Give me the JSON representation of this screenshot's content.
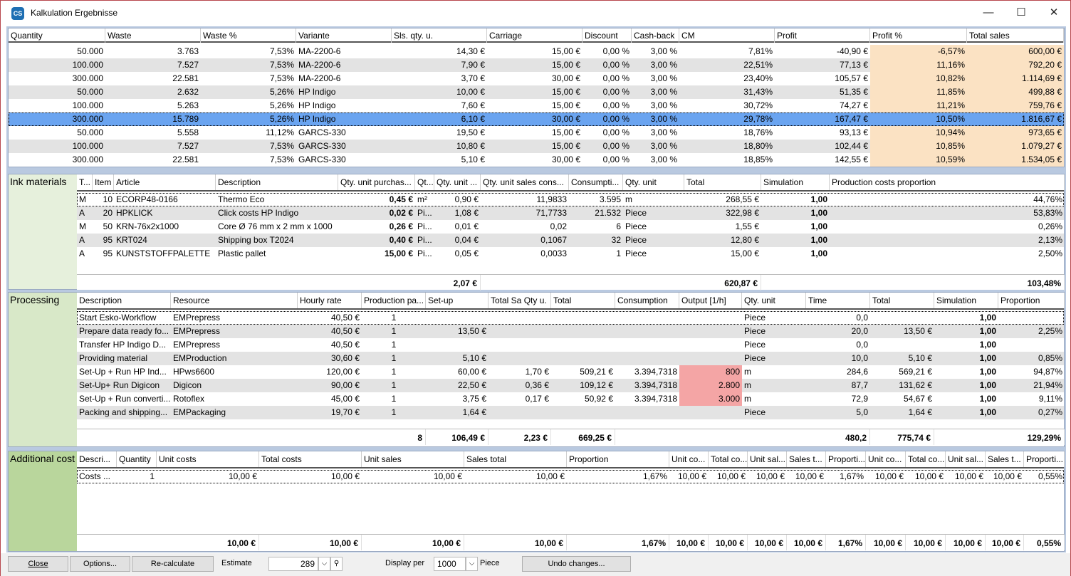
{
  "window": {
    "title": "Kalkulation Ergebnisse",
    "minimize": "—",
    "maximize": "☐",
    "close": "✕"
  },
  "results": {
    "headers": [
      "Quantity",
      "Waste",
      "Waste %",
      "Variante",
      "Sls. qty. u.",
      "Carriage",
      "Discount",
      "Cash-back",
      "CM",
      "Profit",
      "Profit %",
      "Total sales"
    ],
    "rows": [
      [
        "50.000",
        "3.763",
        "7,53%",
        "MA-2200-6",
        "14,30 €",
        "15,00 €",
        "0,00 %",
        "3,00 %",
        "7,81%",
        "-40,90 €",
        "-6,57%",
        "600,00 €"
      ],
      [
        "100.000",
        "7.527",
        "7,53%",
        "MA-2200-6",
        "7,90 €",
        "15,00 €",
        "0,00 %",
        "3,00 %",
        "22,51%",
        "77,13 €",
        "11,16%",
        "792,20 €"
      ],
      [
        "300.000",
        "22.581",
        "7,53%",
        "MA-2200-6",
        "3,70 €",
        "30,00 €",
        "0,00 %",
        "3,00 %",
        "23,40%",
        "105,57 €",
        "10,82%",
        "1.114,69 €"
      ],
      [
        "50.000",
        "2.632",
        "5,26%",
        "HP Indigo",
        "10,00 €",
        "15,00 €",
        "0,00 %",
        "3,00 %",
        "31,43%",
        "51,35 €",
        "11,85%",
        "499,88 €"
      ],
      [
        "100.000",
        "5.263",
        "5,26%",
        "HP Indigo",
        "7,60 €",
        "15,00 €",
        "0,00 %",
        "3,00 %",
        "30,72%",
        "74,27 €",
        "11,21%",
        "759,76 €"
      ],
      [
        "300.000",
        "15.789",
        "5,26%",
        "HP Indigo",
        "6,10 €",
        "30,00 €",
        "0,00 %",
        "3,00 %",
        "29,78%",
        "167,47 €",
        "10,50%",
        "1.816,67 €"
      ],
      [
        "50.000",
        "5.558",
        "11,12%",
        "GARCS-330",
        "19,50 €",
        "15,00 €",
        "0,00 %",
        "3,00 %",
        "18,76%",
        "93,13 €",
        "10,94%",
        "973,65 €"
      ],
      [
        "100.000",
        "7.527",
        "7,53%",
        "GARCS-330",
        "10,80 €",
        "15,00 €",
        "0,00 %",
        "3,00 %",
        "18,80%",
        "102,44 €",
        "10,85%",
        "1.079,27 €"
      ],
      [
        "300.000",
        "22.581",
        "7,53%",
        "GARCS-330",
        "5,10 €",
        "30,00 €",
        "0,00 %",
        "3,00 %",
        "18,85%",
        "142,55 €",
        "10,59%",
        "1.534,05 €"
      ]
    ],
    "selected_row": 5
  },
  "ink": {
    "title": "Ink materials",
    "headers": [
      "T...",
      "Item",
      "Article",
      "Description",
      "Qty. unit purchas...",
      "Qt...",
      "Qty. unit ...",
      "Qty. unit sales cons...",
      "Consumpti...",
      "Qty. unit",
      "Total",
      "Simulation",
      "Production costs proportion"
    ],
    "rows": [
      [
        "M",
        "10",
        "ECORP48-0166",
        "Thermo Eco",
        "0,45 €",
        "m²",
        "0,90 €",
        "11,9833",
        "3.595",
        "m",
        "268,55 €",
        "1,00",
        "44,76%"
      ],
      [
        "A",
        "20",
        "HPKLICK",
        "Click costs HP Indigo",
        "0,02 €",
        "Pi...",
        "1,08 €",
        "71,7733",
        "21.532",
        "Piece",
        "322,98 €",
        "1,00",
        "53,83%"
      ],
      [
        "M",
        "50",
        "KRN-76x2x1000",
        "Core Ø 76 mm x 2 mm x 1000",
        "0,26 €",
        "Pi...",
        "0,01 €",
        "0,02",
        "6",
        "Piece",
        "1,55 €",
        "1,00",
        "0,26%"
      ],
      [
        "A",
        "95",
        "KRT024",
        "Shipping box T2024",
        "0,40 €",
        "Pi...",
        "0,04 €",
        "0,1067",
        "32",
        "Piece",
        "12,80 €",
        "1,00",
        "2,13%"
      ],
      [
        "A",
        "95",
        "KUNSTSTOFFPALETTE",
        "Plastic pallet",
        "15,00 €",
        "Pi...",
        "0,05 €",
        "0,0033",
        "1",
        "Piece",
        "15,00 €",
        "1,00",
        "2,50%"
      ]
    ],
    "totals": [
      "2,07 €",
      "620,87 €",
      "103,48%"
    ]
  },
  "processing": {
    "title": "Processing",
    "headers": [
      "Description",
      "Resource",
      "Hourly rate",
      "Production pa...",
      "Set-up",
      "Total Sa Qty u.",
      "Total",
      "Consumption",
      "Output [1/h]",
      "Qty. unit",
      "Time",
      "Total",
      "Simulation",
      "Proportion"
    ],
    "rows": [
      [
        "Start Esko-Workflow",
        "EMPrepress",
        "40,50 €",
        "1",
        "",
        "",
        "",
        "",
        "",
        "Piece",
        "0,0",
        "",
        "1,00",
        ""
      ],
      [
        "Prepare data ready fo...",
        "EMPrepress",
        "40,50 €",
        "1",
        "13,50 €",
        "",
        "",
        "",
        "",
        "Piece",
        "20,0",
        "13,50 €",
        "1,00",
        "2,25%"
      ],
      [
        "Transfer HP Indigo D...",
        "EMPrepress",
        "40,50 €",
        "1",
        "",
        "",
        "",
        "",
        "",
        "Piece",
        "0,0",
        "",
        "1,00",
        ""
      ],
      [
        "Providing material",
        "EMProduction",
        "30,60 €",
        "1",
        "5,10 €",
        "",
        "",
        "",
        "",
        "Piece",
        "10,0",
        "5,10 €",
        "1,00",
        "0,85%"
      ],
      [
        "Set-Up + Run  HP Ind...",
        "HPws6600",
        "120,00 €",
        "1",
        "60,00 €",
        "1,70 €",
        "509,21 €",
        "3.394,7318",
        "800",
        "m",
        "284,6",
        "569,21 €",
        "1,00",
        "94,87%"
      ],
      [
        "Set-Up+ Run Digicon",
        "Digicon",
        "90,00 €",
        "1",
        "22,50 €",
        "0,36 €",
        "109,12 €",
        "3.394,7318",
        "2.800",
        "m",
        "87,7",
        "131,62 €",
        "1,00",
        "21,94%"
      ],
      [
        "Set-Up + Run converti...",
        "Rotoflex",
        "45,00 €",
        "1",
        "3,75 €",
        "0,17 €",
        "50,92 €",
        "3.394,7318",
        "3.000",
        "m",
        "72,9",
        "54,67 €",
        "1,00",
        "9,11%"
      ],
      [
        "Packing and shipping...",
        "EMPackaging",
        "19,70 €",
        "1",
        "1,64 €",
        "",
        "",
        "",
        "",
        "Piece",
        "5,0",
        "1,64 €",
        "1,00",
        "0,27%"
      ]
    ],
    "totals": [
      "8",
      "106,49 €",
      "2,23 €",
      "669,25 €",
      "480,2",
      "775,74 €",
      "129,29%"
    ]
  },
  "additional": {
    "title": "Additional cost",
    "headers": [
      "Descri...",
      "Quantity",
      "Unit costs",
      "Total costs",
      "Unit sales",
      "Sales total",
      "Proportion",
      "Unit co...",
      "Total co...",
      "Unit sal...",
      "Sales t...",
      "Proporti...",
      "Unit co...",
      "Total co...",
      "Unit sal...",
      "Sales t...",
      "Proporti..."
    ],
    "rows": [
      [
        "Costs ...",
        "1",
        "10,00 €",
        "10,00 €",
        "10,00 €",
        "10,00 €",
        "1,67%",
        "10,00 €",
        "10,00 €",
        "10,00 €",
        "10,00 €",
        "1,67%",
        "10,00 €",
        "10,00 €",
        "10,00 €",
        "10,00 €",
        "0,55%"
      ]
    ],
    "totals": [
      "10,00 €",
      "10,00 €",
      "10,00 €",
      "10,00 €",
      "1,67%",
      "10,00 €",
      "10,00 €",
      "10,00 €",
      "10,00 €",
      "1,67%",
      "10,00 €",
      "10,00 €",
      "10,00 €",
      "10,00 €",
      "0,55%"
    ]
  },
  "footer": {
    "close_label": "Close",
    "options_label": "Options...",
    "recalc_label": "Re-calculate",
    "estimate_label": "Estimate",
    "estimate_value": "289",
    "display_per_label": "Display per",
    "display_per_value": "1000",
    "unit_label": "Piece",
    "undo_label": "Undo changes..."
  }
}
